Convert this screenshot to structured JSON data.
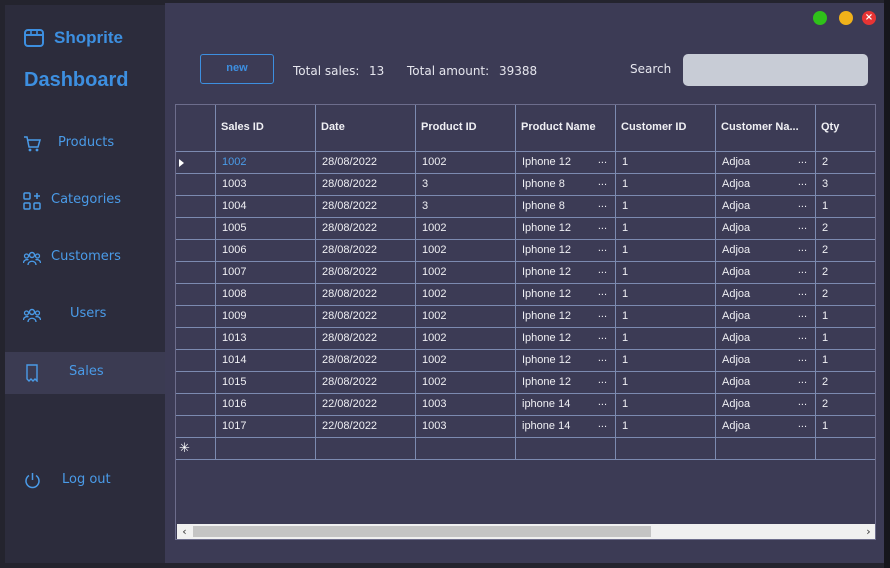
{
  "sidebar": {
    "brand": "Shoprite",
    "title": "Dashboard",
    "items": [
      {
        "label": "Products",
        "icon": "cart-icon"
      },
      {
        "label": "Categories",
        "icon": "categories-icon"
      },
      {
        "label": "Customers",
        "icon": "customers-icon"
      },
      {
        "label": "Users",
        "icon": "users-icon"
      },
      {
        "label": "Sales",
        "icon": "receipt-icon",
        "active": true
      }
    ],
    "logout": "Log out"
  },
  "toolbar": {
    "new_label": "new",
    "total_sales_label": "Total sales:",
    "total_sales_value": "13",
    "total_amount_label": "Total amount:",
    "total_amount_value": "39388",
    "search_label": "Search",
    "search_value": ""
  },
  "window": {
    "close_symbol": "×"
  },
  "table": {
    "columns": [
      "Sales ID",
      "Date",
      "Product ID",
      "Product Name",
      "Customer ID",
      "Customer Na...",
      "Qty"
    ],
    "rows": [
      [
        "1002",
        "28/08/2022",
        "1002",
        "Iphone 12",
        "1",
        "Adjoa",
        "2"
      ],
      [
        "1003",
        "28/08/2022",
        "3",
        "Iphone 8",
        "1",
        "Adjoa",
        "3"
      ],
      [
        "1004",
        "28/08/2022",
        "3",
        "Iphone 8",
        "1",
        "Adjoa",
        "1"
      ],
      [
        "1005",
        "28/08/2022",
        "1002",
        "Iphone 12",
        "1",
        "Adjoa",
        "2"
      ],
      [
        "1006",
        "28/08/2022",
        "1002",
        "Iphone 12",
        "1",
        "Adjoa",
        "2"
      ],
      [
        "1007",
        "28/08/2022",
        "1002",
        "Iphone 12",
        "1",
        "Adjoa",
        "2"
      ],
      [
        "1008",
        "28/08/2022",
        "1002",
        "Iphone 12",
        "1",
        "Adjoa",
        "2"
      ],
      [
        "1009",
        "28/08/2022",
        "1002",
        "Iphone 12",
        "1",
        "Adjoa",
        "1"
      ],
      [
        "1013",
        "28/08/2022",
        "1002",
        "Iphone 12",
        "1",
        "Adjoa",
        "1"
      ],
      [
        "1014",
        "28/08/2022",
        "1002",
        "Iphone 12",
        "1",
        "Adjoa",
        "1"
      ],
      [
        "1015",
        "28/08/2022",
        "1002",
        "Iphone 12",
        "1",
        "Adjoa",
        "2"
      ],
      [
        "1016",
        "22/08/2022",
        "1003",
        "iphone 14",
        "1",
        "Adjoa",
        "2"
      ],
      [
        "1017",
        "22/08/2022",
        "1003",
        "iphone 14",
        "1",
        "Adjoa",
        "1"
      ]
    ],
    "ellipsis": "...",
    "new_row_marker": "✳"
  },
  "colors": {
    "accent": "#3d8fe0",
    "sidebar_bg": "#2c2c3c",
    "main_bg": "#3c3b55",
    "active_nav": "#3b3b52"
  }
}
